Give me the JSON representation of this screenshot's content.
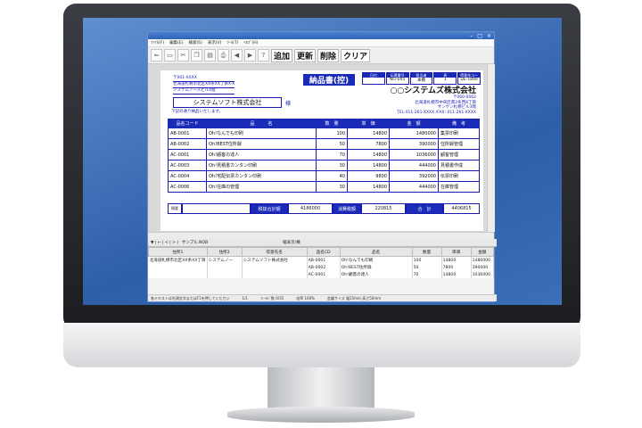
{
  "window": {
    "min": "–",
    "max": "□",
    "close": "×"
  },
  "menu": [
    "ﾌｧｲﾙ(F)",
    "編集(E)",
    "検索(S)",
    "表示(V)",
    "ﾂｰﾙ(T)",
    "ﾍﾙﾌﾟ(H)"
  ],
  "toolbar": {
    "add": "追加",
    "update": "更新",
    "delete": "削除",
    "clear": "クリア",
    "help_icon": "?"
  },
  "doc": {
    "postal": "〒001-XXXX",
    "address1": "北海道札幌市北区XX条XX丁目X-X",
    "address2": "システムノースビル4階",
    "customer": "システムソフト株式会社",
    "honorific": "様",
    "note": "下記の通り納品いたします。",
    "title": "納品書(控)",
    "code_headers": [
      "日付",
      "伝票番号",
      "担当者",
      "頁",
      "得意先コード"
    ],
    "code_values": [
      "",
      "NO-005",
      "本橋",
      "1",
      "DE-1890"
    ],
    "company": "○○システムズ株式会社",
    "company_postal": "〒060-0062",
    "company_addr1": "北海道札幌市中央区南2条西8丁目",
    "company_addr2": "サンケン札幌ビル3階",
    "company_tel": "TEL:011-261-XXXX /FAX: 011-261-XXXX",
    "headers": [
      "品名コード",
      "品　　　名",
      "数　量",
      "単　価",
      "金　額",
      "備　考"
    ],
    "rows": [
      {
        "code": "AB-0001",
        "name": "Oh!なんでも印刷",
        "qty": "100",
        "price": "14800",
        "amount": "1480000",
        "note": "集票印刷"
      },
      {
        "code": "AB-0002",
        "name": "Oh!BEST住所録",
        "qty": "50",
        "price": "7800",
        "amount": "390000",
        "note": "住所録管理"
      },
      {
        "code": "AC-0001",
        "name": "Oh!顧客の達人",
        "qty": "70",
        "price": "14800",
        "amount": "1036000",
        "note": "顧客管理"
      },
      {
        "code": "AC-0003",
        "name": "Oh!見積書カンタン印刷",
        "qty": "30",
        "price": "14800",
        "amount": "444000",
        "note": "見積書作成"
      },
      {
        "code": "AC-0004",
        "name": "Oh!宅配伝票カンタン印刷",
        "qty": "40",
        "price": "9800",
        "amount": "392000",
        "note": "伝票印刷"
      },
      {
        "code": "AC-0006",
        "name": "Oh!在庫の管理",
        "qty": "30",
        "price": "14800",
        "amount": "444000",
        "note": "在庫管理"
      }
    ],
    "memo_label": "摘要",
    "subtotal_label": "税抜合計額",
    "subtotal": "4186000",
    "tax_label": "消費税額",
    "tax": "220815",
    "total_label": "合　計",
    "total": "4406815"
  },
  "pane": {
    "nav": "▼ | ← | < | > |",
    "file": "サンプル.NOB",
    "view_label": "縦表示/横"
  },
  "grid": {
    "headers": [
      "住所1",
      "住所2",
      "得意先名",
      "品名CD",
      "品名",
      "数量",
      "単価",
      "金額"
    ],
    "rows": [
      [
        "北海道札幌市北区XX条XX丁目",
        "システムノー",
        "システムソフト株式会社",
        "AB-0001",
        "Oh!なんでも印刷",
        "100",
        "14800",
        "1480000"
      ],
      [
        "",
        "",
        "",
        "AB-0002",
        "Oh!BEST住所録",
        "50",
        "7800",
        "390000"
      ],
      [
        "",
        "",
        "",
        "AC-0001",
        "Oh!顧客の達人",
        "70",
        "14800",
        "1036000"
      ]
    ]
  },
  "status": [
    "各テキストは先頭文字またはF1を押してください",
    "1/1",
    "ﾌｨｰﾙﾄﾞ数 0/35",
    "倍率 100%",
    "会議サイズ 幅15mm 高さ50mm"
  ]
}
